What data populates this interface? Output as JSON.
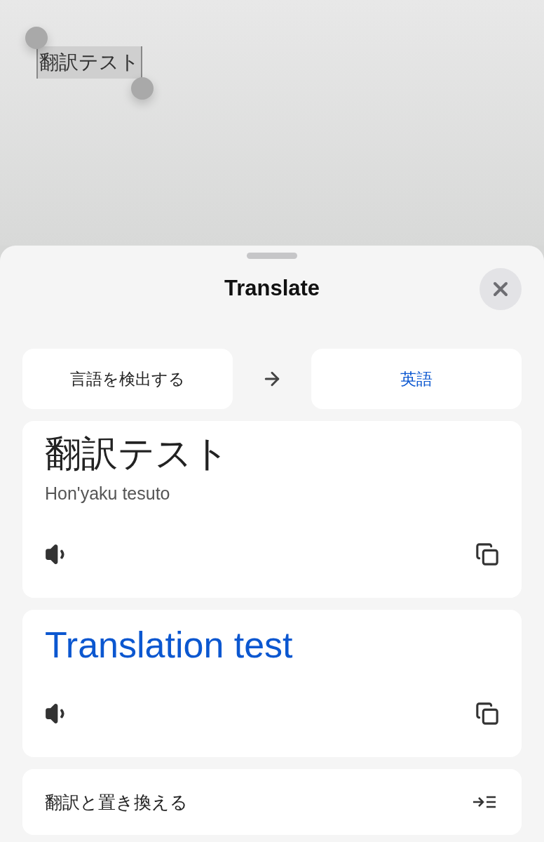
{
  "selected_text": "翻訳テスト",
  "sheet": {
    "title": "Translate"
  },
  "languages": {
    "source": "言語を検出する",
    "target": "英語"
  },
  "source_card": {
    "text": "翻訳テスト",
    "romanization": "Hon'yaku tesuto"
  },
  "target_card": {
    "text": "Translation test"
  },
  "replace_action": {
    "label": "翻訳と置き換える"
  }
}
